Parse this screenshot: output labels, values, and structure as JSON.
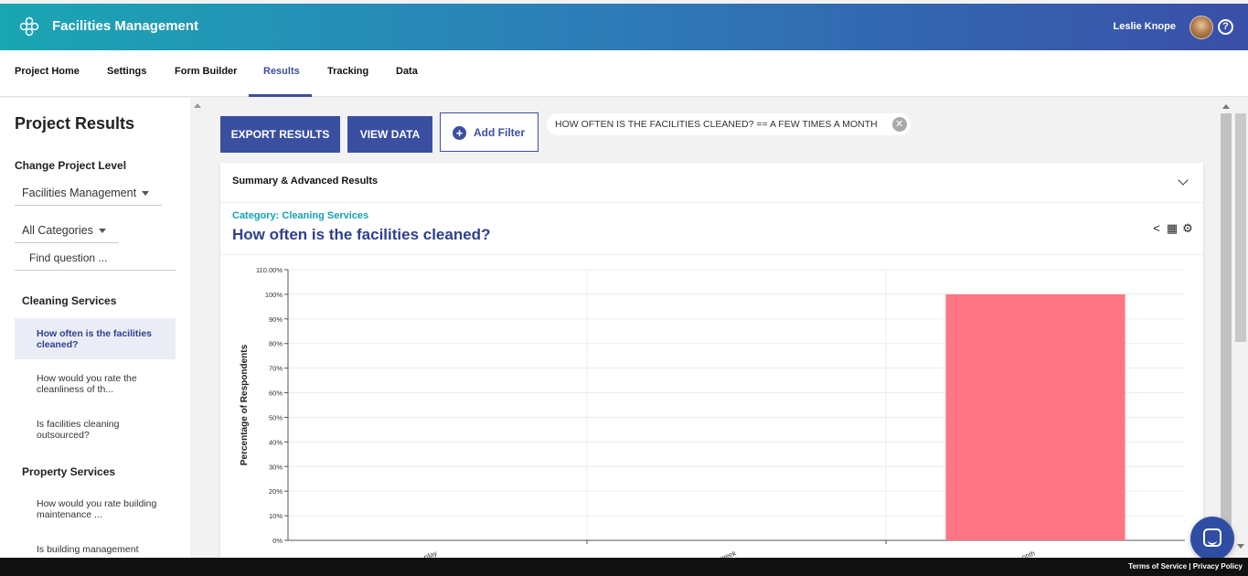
{
  "header": {
    "app_title": "Facilities Management",
    "user_name": "Leslie Knope",
    "help_glyph": "?",
    "icons": {
      "logo": "flower-logo-icon",
      "help": "help-circle-icon",
      "avatar": "user-avatar"
    }
  },
  "nav": {
    "tabs": [
      {
        "label": "Project Home"
      },
      {
        "label": "Settings"
      },
      {
        "label": "Form Builder"
      },
      {
        "label": "Results",
        "active": true
      },
      {
        "label": "Tracking"
      },
      {
        "label": "Data"
      }
    ]
  },
  "sidebar": {
    "title": "Project Results",
    "change_level_label": "Change Project Level",
    "project_level_value": "Facilities Management",
    "category_value": "All Categories",
    "find_placeholder": "Find question ...",
    "sections": [
      {
        "name": "Cleaning Services",
        "questions": [
          {
            "text": "How often is the facilities cleaned?",
            "active": true
          },
          {
            "text": "How would you rate the cleanliness of th..."
          },
          {
            "text": "Is facilities cleaning outsourced?"
          }
        ]
      },
      {
        "name": "Property Services",
        "questions": [
          {
            "text": "How would you rate building maintenance ..."
          },
          {
            "text": "Is building management"
          }
        ]
      }
    ]
  },
  "actions": {
    "export_label": "EXPORT RESULTS",
    "view_data_label": "VIEW DATA",
    "add_filter_label": "Add Filter",
    "filter_chip": "HOW OFTEN IS THE FACILITIES CLEANED? == A FEW TIMES A MONTH",
    "chip_close_glyph": "✕"
  },
  "card": {
    "summary_label": "Summary & Advanced Results",
    "category_label": "Category: Cleaning Services",
    "question_title": "How often is the facilities cleaned?",
    "tool_icons": [
      "share-icon",
      "table-icon",
      "gear-icon"
    ],
    "tool_glyphs": [
      "<",
      "▦",
      "⚙"
    ]
  },
  "chart_data": {
    "type": "bar",
    "categories": [
      "...rday",
      "...week",
      "...onth"
    ],
    "values": [
      0,
      0,
      100
    ],
    "ylabel": "Percentage of Respondents",
    "ylim": [
      0,
      110
    ],
    "yticks": [
      "0%",
      "10%",
      "20%",
      "30%",
      "40%",
      "50%",
      "60%",
      "70%",
      "80%",
      "90%",
      "100%",
      "110.00%"
    ],
    "ytick_values": [
      0,
      10,
      20,
      30,
      40,
      50,
      60,
      70,
      80,
      90,
      100,
      110
    ],
    "bar_color": "#ff7583",
    "grid": true
  },
  "footer": {
    "terms_label": "Terms of Service",
    "separator": " | ",
    "privacy_label": "Privacy Policy"
  }
}
